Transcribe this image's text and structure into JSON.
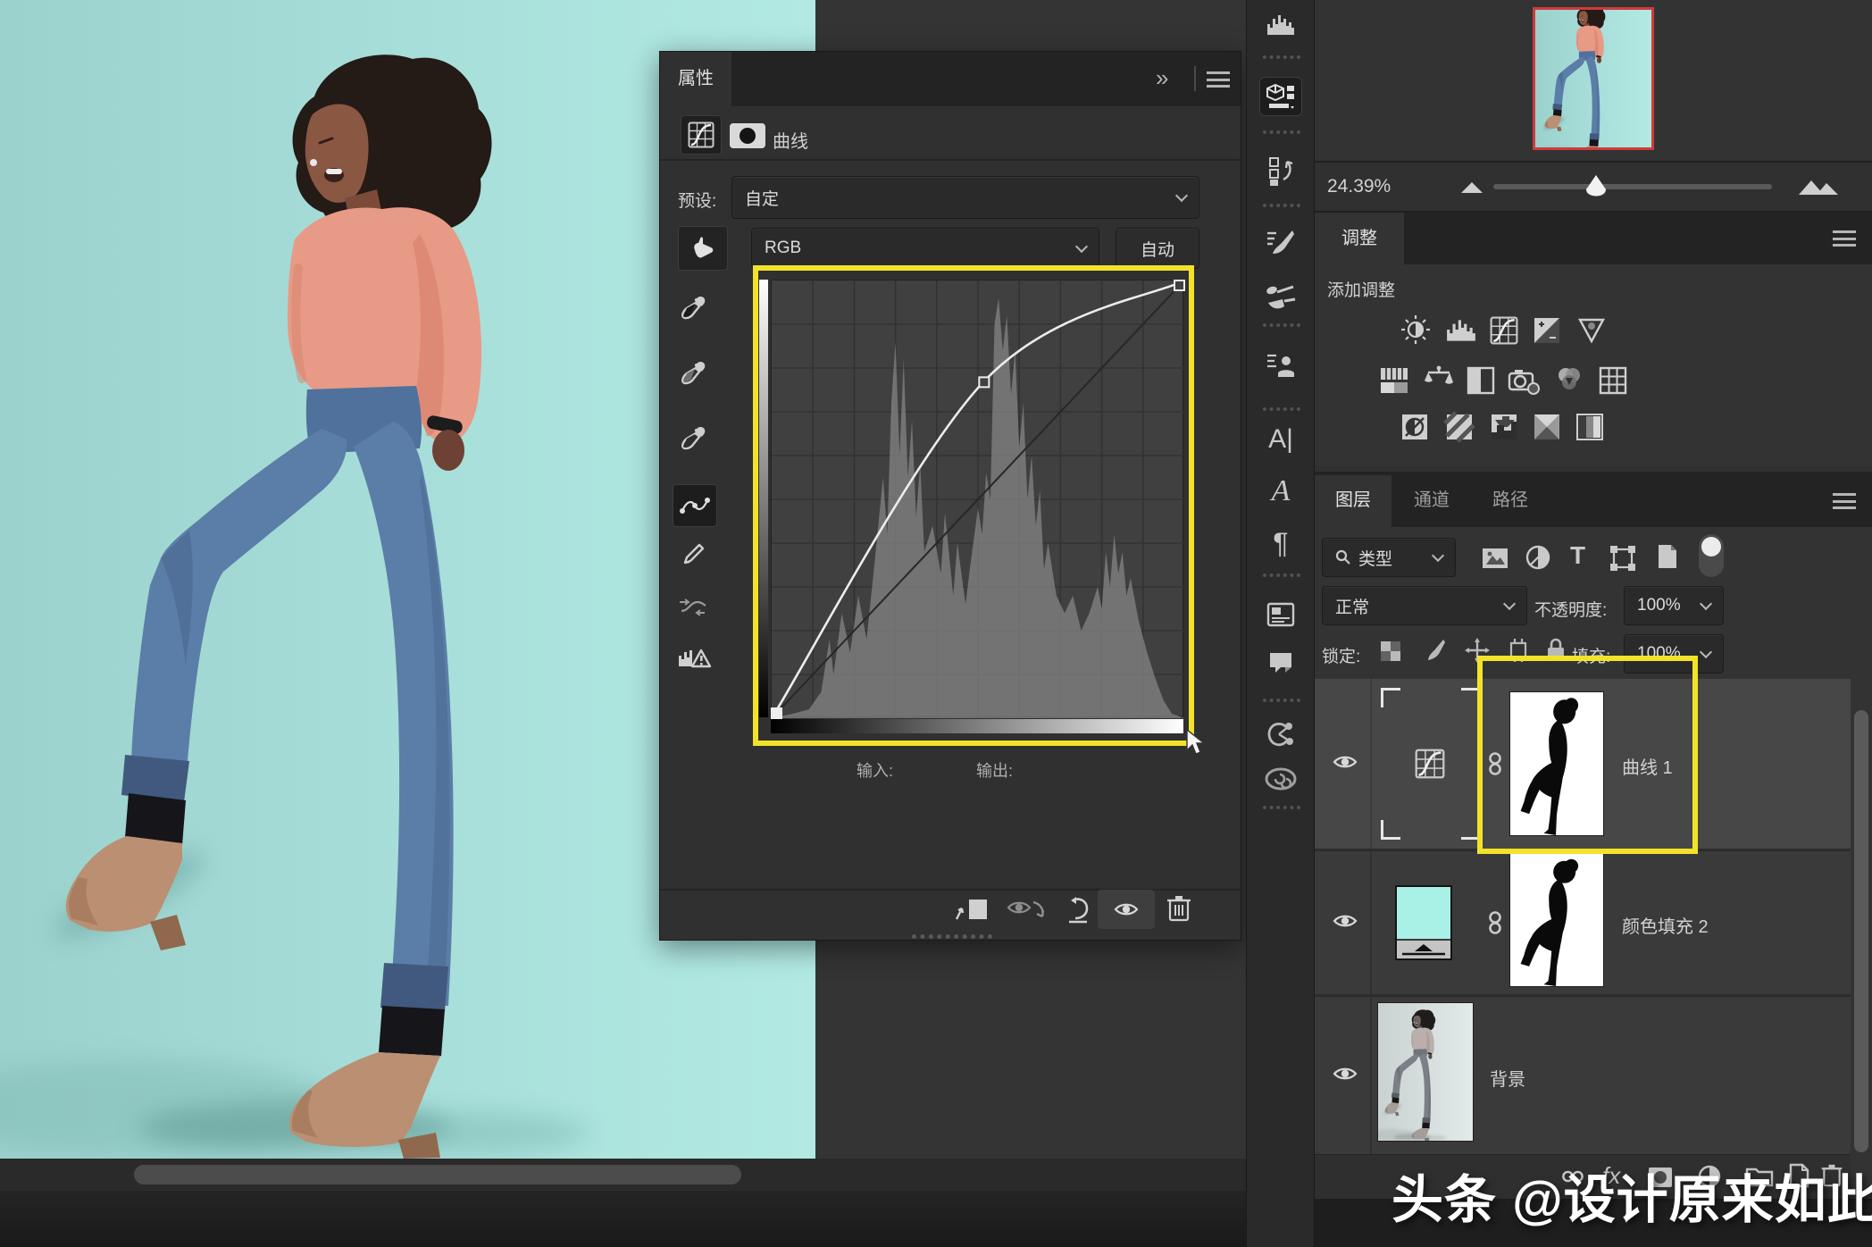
{
  "app": {
    "watermark": "头条 @设计原来如此"
  },
  "colors": {
    "accent_yellow": "#f2e32a",
    "canvas_teal": "#a6dcd8",
    "cyan_fill": "#a9f0e6",
    "navigator_view_red": "#cf3b3b"
  },
  "properties_panel": {
    "tab": "属性",
    "adjustment_title": "曲线",
    "preset_label": "预设:",
    "preset_value": "自定",
    "channel": "RGB",
    "auto_button": "自动",
    "input_label": "输入:",
    "output_label": "输出:",
    "curve": {
      "points": [
        [
          0,
          0
        ],
        [
          131,
          196
        ],
        [
          255,
          255
        ]
      ]
    },
    "histogram": [
      [
        0,
        0
      ],
      [
        0.05,
        0.01
      ],
      [
        0.09,
        0.02
      ],
      [
        0.12,
        0.06
      ],
      [
        0.14,
        0.18
      ],
      [
        0.15,
        0.1
      ],
      [
        0.17,
        0.24
      ],
      [
        0.19,
        0.15
      ],
      [
        0.21,
        0.28
      ],
      [
        0.23,
        0.18
      ],
      [
        0.25,
        0.36
      ],
      [
        0.27,
        0.55
      ],
      [
        0.28,
        0.42
      ],
      [
        0.29,
        0.72
      ],
      [
        0.3,
        0.86
      ],
      [
        0.31,
        0.6
      ],
      [
        0.32,
        0.82
      ],
      [
        0.33,
        0.55
      ],
      [
        0.34,
        0.68
      ],
      [
        0.35,
        0.46
      ],
      [
        0.36,
        0.58
      ],
      [
        0.37,
        0.38
      ],
      [
        0.39,
        0.44
      ],
      [
        0.41,
        0.33
      ],
      [
        0.42,
        0.47
      ],
      [
        0.44,
        0.28
      ],
      [
        0.45,
        0.4
      ],
      [
        0.47,
        0.26
      ],
      [
        0.48,
        0.34
      ],
      [
        0.5,
        0.48
      ],
      [
        0.51,
        0.42
      ],
      [
        0.52,
        0.56
      ],
      [
        0.53,
        0.5
      ],
      [
        0.54,
        0.9
      ],
      [
        0.55,
        0.96
      ],
      [
        0.56,
        0.84
      ],
      [
        0.57,
        0.92
      ],
      [
        0.58,
        0.74
      ],
      [
        0.59,
        0.84
      ],
      [
        0.6,
        0.62
      ],
      [
        0.61,
        0.72
      ],
      [
        0.62,
        0.5
      ],
      [
        0.63,
        0.6
      ],
      [
        0.64,
        0.44
      ],
      [
        0.65,
        0.52
      ],
      [
        0.66,
        0.34
      ],
      [
        0.67,
        0.4
      ],
      [
        0.69,
        0.28
      ],
      [
        0.71,
        0.24
      ],
      [
        0.73,
        0.28
      ],
      [
        0.75,
        0.2
      ],
      [
        0.77,
        0.24
      ],
      [
        0.79,
        0.3
      ],
      [
        0.8,
        0.25
      ],
      [
        0.81,
        0.38
      ],
      [
        0.82,
        0.3
      ],
      [
        0.83,
        0.42
      ],
      [
        0.84,
        0.33
      ],
      [
        0.85,
        0.38
      ],
      [
        0.86,
        0.28
      ],
      [
        0.87,
        0.32
      ],
      [
        0.89,
        0.22
      ],
      [
        0.91,
        0.15
      ],
      [
        0.93,
        0.09
      ],
      [
        0.95,
        0.04
      ],
      [
        0.97,
        0.01
      ],
      [
        1,
        0
      ]
    ],
    "tool_icons": [
      "targeted-adjustment",
      "black-point-eyedropper",
      "gray-point-eyedropper",
      "white-point-eyedropper",
      "curve-point-tool",
      "pencil-curve-tool",
      "smooth-curve",
      "histogram-clip-warning"
    ],
    "footer_icons": [
      "clip-to-layer",
      "toggle-previous-state",
      "reset",
      "visibility",
      "delete"
    ]
  },
  "navigator": {
    "zoom": "24.39%"
  },
  "adjustments_panel": {
    "tab": "调整",
    "add_label": "添加调整",
    "icons": [
      "brightness-contrast",
      "levels",
      "curves",
      "exposure",
      "vibrance",
      "hue-saturation",
      "color-balance",
      "black-white",
      "photo-filter",
      "channel-mixer",
      "color-lookup",
      "invert",
      "posterize",
      "threshold",
      "selective-color",
      "gradient-map"
    ]
  },
  "layers_panel": {
    "tabs": {
      "layers": "图层",
      "channels": "通道",
      "paths": "路径"
    },
    "filter_label": "类型",
    "blend_mode": "正常",
    "opacity_label": "不透明度:",
    "opacity_value": "100%",
    "lock_label": "锁定:",
    "fill_label": "填充:",
    "fill_value": "100%",
    "layers": [
      {
        "name": "曲线 1",
        "type": "curves-adjustment",
        "selected": true
      },
      {
        "name": "颜色填充 2",
        "type": "solid-color-fill",
        "selected": false
      },
      {
        "name": "背景",
        "type": "background-image",
        "selected": false
      }
    ]
  },
  "panel_strip_icons": [
    "histogram",
    "properties",
    "history",
    "brush-settings",
    "brushes",
    "clone-source",
    "character",
    "glyphs",
    "paragraph",
    "layer-comps",
    "notes",
    "share",
    "creative-cloud"
  ]
}
